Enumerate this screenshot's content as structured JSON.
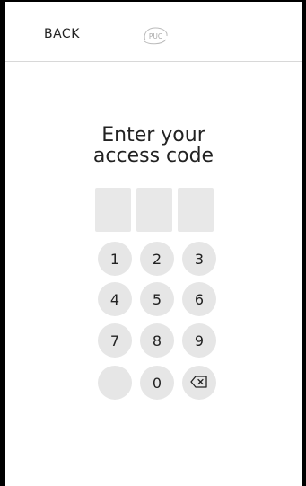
{
  "header": {
    "back_label": "BACK",
    "logo_text": "PUC"
  },
  "prompt": {
    "line1": "Enter your",
    "line2": "access code"
  },
  "code": {
    "digits": [
      "",
      "",
      ""
    ]
  },
  "keypad": {
    "k1": "1",
    "k2": "2",
    "k3": "3",
    "k4": "4",
    "k5": "5",
    "k6": "6",
    "k7": "7",
    "k8": "8",
    "k9": "9",
    "k0": "0",
    "blank": "",
    "backspace_icon": "backspace-icon"
  },
  "colors": {
    "key_bg": "#e6e6e6",
    "box_bg": "#e8e8e8",
    "text": "#222222"
  }
}
